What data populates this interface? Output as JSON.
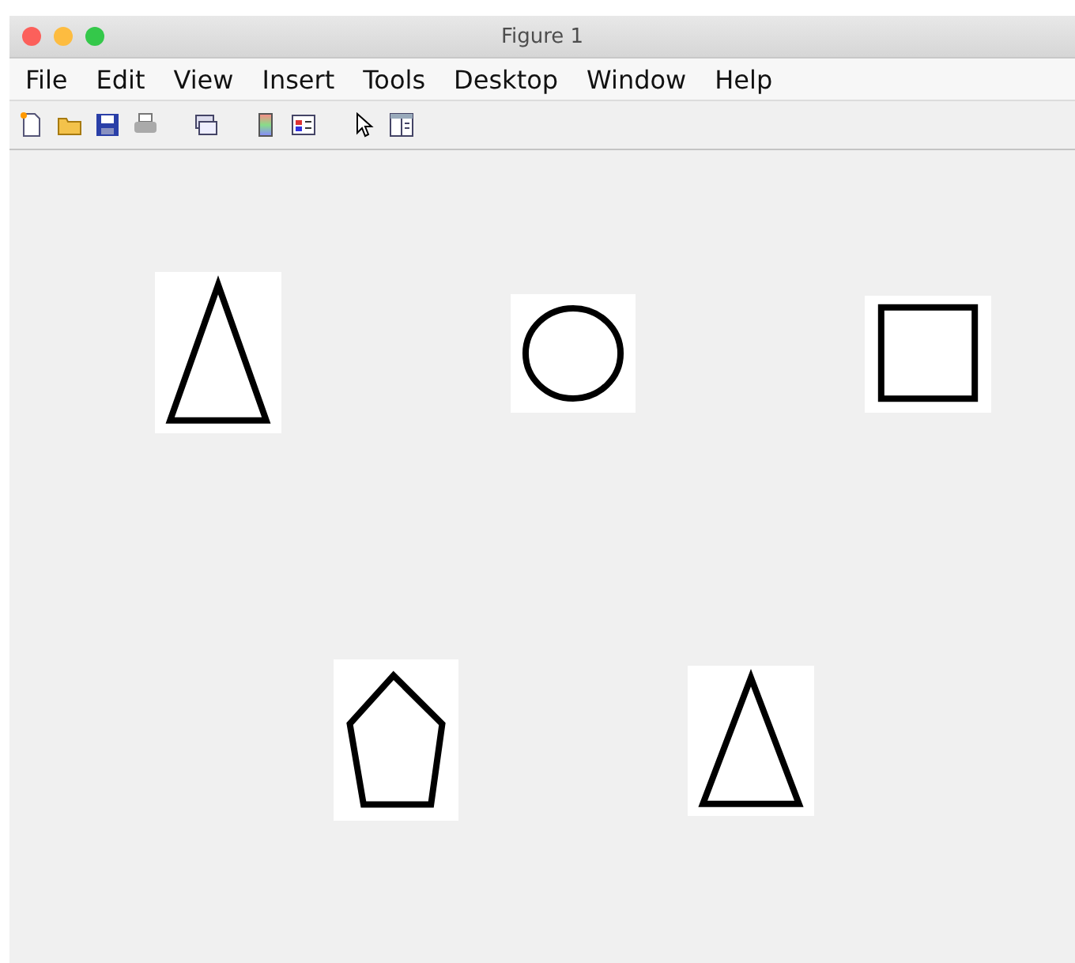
{
  "window": {
    "title": "Figure 1"
  },
  "menu": [
    "File",
    "Edit",
    "View",
    "Insert",
    "Tools",
    "Desktop",
    "Window",
    "Help"
  ],
  "figure": {
    "shapes": [
      {
        "kind": "triangle"
      },
      {
        "kind": "circle"
      },
      {
        "kind": "square"
      },
      {
        "kind": "pentagon"
      },
      {
        "kind": "triangle"
      }
    ]
  }
}
